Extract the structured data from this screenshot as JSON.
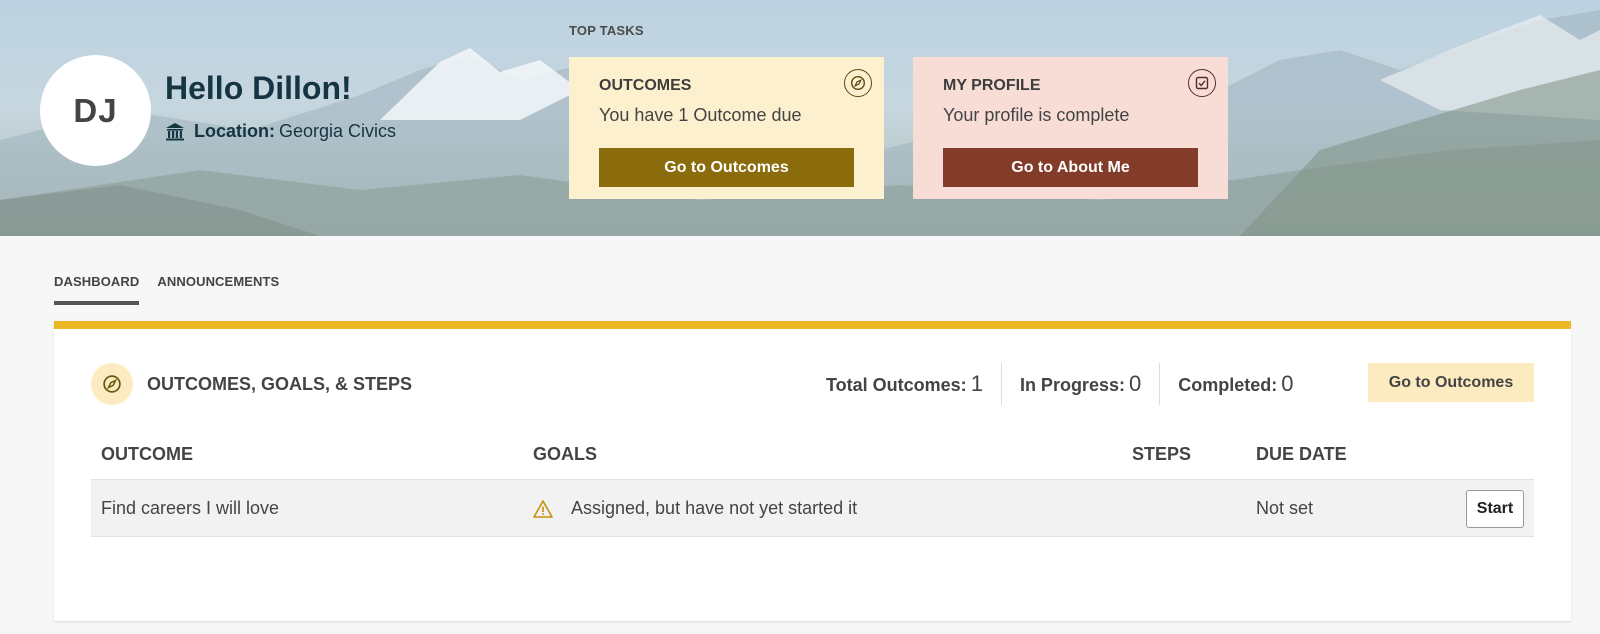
{
  "user": {
    "initials": "DJ",
    "greeting": "Hello Dillon!",
    "location_label": "Location:",
    "location_value": "Georgia Civics"
  },
  "top_tasks": {
    "label": "TOP TASKS",
    "cards": [
      {
        "title": "OUTCOMES",
        "text": "You have 1 Outcome due",
        "button": "Go to Outcomes",
        "icon": "compass-icon",
        "color": "#8a6c0d"
      },
      {
        "title": "MY PROFILE",
        "text": "Your profile is complete",
        "button": "Go to About Me",
        "icon": "checkbox-icon",
        "color": "#843c2a"
      }
    ]
  },
  "tabs": [
    {
      "label": "DASHBOARD",
      "active": true
    },
    {
      "label": "ANNOUNCEMENTS",
      "active": false
    }
  ],
  "panel": {
    "accent": "#ecb824",
    "title": "OUTCOMES, GOALS, & STEPS",
    "stats": [
      {
        "label": "Total Outcomes:",
        "value": "1"
      },
      {
        "label": "In Progress:",
        "value": "0"
      },
      {
        "label": "Completed:",
        "value": "0"
      }
    ],
    "button": "Go to Outcomes",
    "columns": [
      "OUTCOME",
      "GOALS",
      "STEPS",
      "DUE DATE"
    ],
    "rows": [
      {
        "outcome": "Find careers I will love",
        "goals": "Assigned, but have not yet started it",
        "steps": "",
        "due_date": "Not set",
        "action": "Start"
      }
    ]
  }
}
